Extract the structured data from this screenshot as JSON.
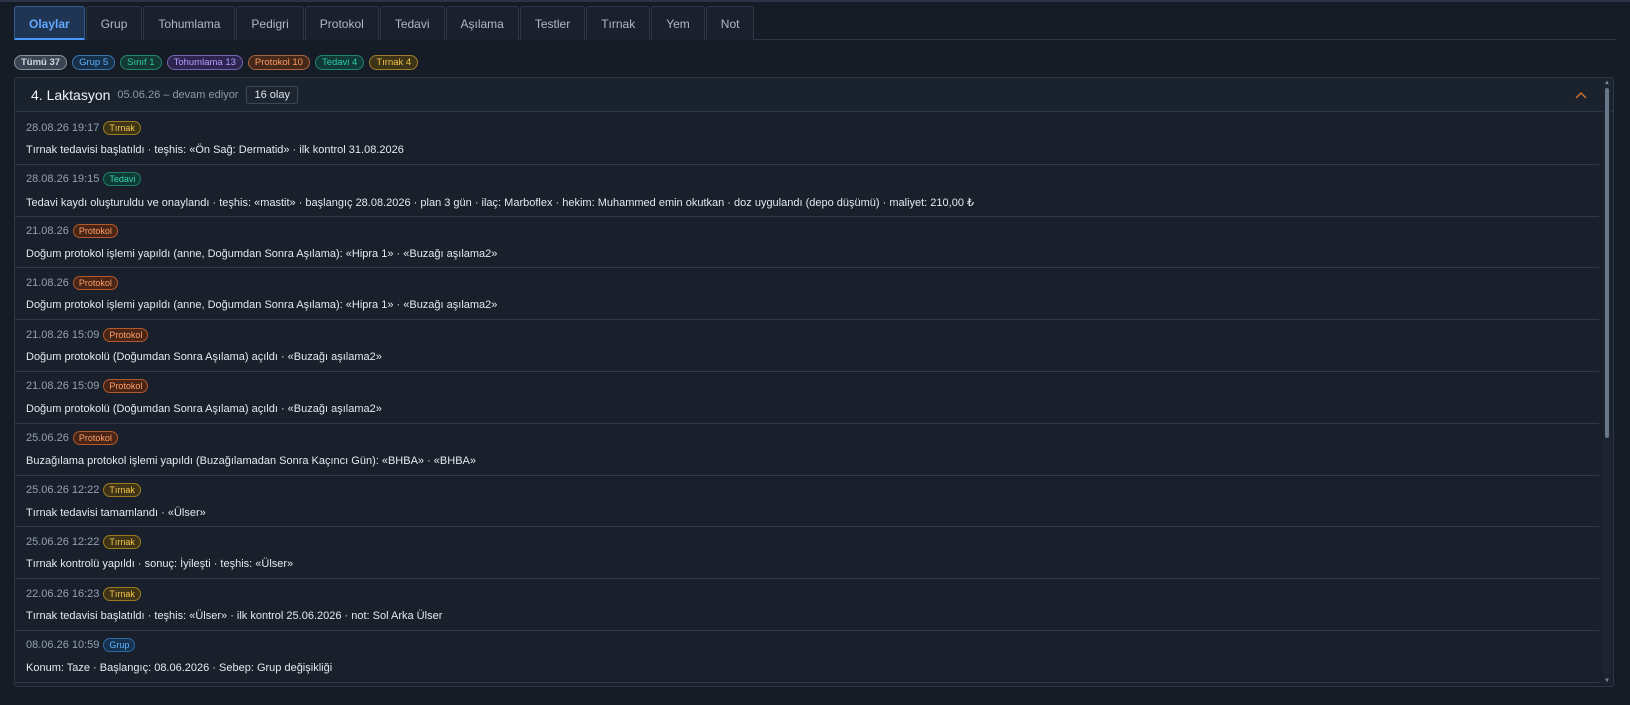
{
  "tabs": [
    {
      "label": "Olaylar",
      "active": true
    },
    {
      "label": "Grup"
    },
    {
      "label": "Tohumlama"
    },
    {
      "label": "Pedigri"
    },
    {
      "label": "Protokol"
    },
    {
      "label": "Tedavi"
    },
    {
      "label": "Aşılama"
    },
    {
      "label": "Testler"
    },
    {
      "label": "Tırnak"
    },
    {
      "label": "Yem"
    },
    {
      "label": "Not"
    }
  ],
  "filters": [
    {
      "label": "Tümü 37",
      "color": "#cfd6e0",
      "bg": "#3a4352",
      "active": true
    },
    {
      "label": "Grup 5",
      "color": "#5db2ff",
      "bg": "#173049"
    },
    {
      "label": "Sınıf 1",
      "color": "#34c8a0",
      "bg": "#123a33"
    },
    {
      "label": "Tohumlama 13",
      "color": "#b89bff",
      "bg": "#2c2550"
    },
    {
      "label": "Protokol 10",
      "color": "#ff9a60",
      "bg": "#45281a"
    },
    {
      "label": "Tedavi 4",
      "color": "#2ec9b0",
      "bg": "#113935"
    },
    {
      "label": "Tırnak 4",
      "color": "#f1c24a",
      "bg": "#3d3317"
    }
  ],
  "lactation": {
    "title": "4. Laktasyon",
    "range": "05.06.26 – devam ediyor",
    "count": "16 olay"
  },
  "tag_styles": {
    "Tırnak": {
      "color": "#f3c64d",
      "bg": "#3f3415",
      "border": "#9a7c22"
    },
    "Tedavi": {
      "color": "#36d1b4",
      "bg": "#0f3a34",
      "border": "#1f7d6d"
    },
    "Protokol": {
      "color": "#ffa06a",
      "bg": "#4a2414",
      "border": "#b25a2c"
    },
    "Grup": {
      "color": "#62b6ff",
      "bg": "#15324f",
      "border": "#2d6aa6"
    }
  },
  "events": [
    {
      "time": "28.08.26 19:17",
      "tag": "Tırnak",
      "desc": "Tırnak tedavisi başlatıldı · teşhis: «Ön Sağ: Dermatid» · ilk kontrol 31.08.2026"
    },
    {
      "time": "28.08.26 19:15",
      "tag": "Tedavi",
      "desc": "Tedavi kaydı oluşturuldu ve onaylandı · teşhis: «mastit» · başlangıç 28.08.2026 · plan 3 gün · ilaç: Marboflex · hekim: Muhammed emin okutkan · doz uygulandı (depo düşümü) · maliyet: 210,00 ₺"
    },
    {
      "time": "21.08.26",
      "tag": "Protokol",
      "desc": "Doğum protokol işlemi yapıldı (anne, Doğumdan Sonra Aşılama): «Hipra 1» · «Buzağı aşılama2»"
    },
    {
      "time": "21.08.26",
      "tag": "Protokol",
      "desc": "Doğum protokol işlemi yapıldı (anne, Doğumdan Sonra Aşılama): «Hipra 1» · «Buzağı aşılama2»"
    },
    {
      "time": "21.08.26 15:09",
      "tag": "Protokol",
      "desc": "Doğum protokolü (Doğumdan Sonra Aşılama) açıldı · «Buzağı aşılama2»"
    },
    {
      "time": "21.08.26 15:09",
      "tag": "Protokol",
      "desc": "Doğum protokolü (Doğumdan Sonra Aşılama) açıldı · «Buzağı aşılama2»"
    },
    {
      "time": "25.06.26",
      "tag": "Protokol",
      "desc": "Buzağılama protokol işlemi yapıldı (Buzağılamadan Sonra Kaçıncı Gün): «BHBA» · «BHBA»"
    },
    {
      "time": "25.06.26 12:22",
      "tag": "Tırnak",
      "desc": "Tırnak tedavisi tamamlandı · «Ülser»"
    },
    {
      "time": "25.06.26 12:22",
      "tag": "Tırnak",
      "desc": "Tırnak kontrolü yapıldı · sonuç: İyileşti · teşhis: «Ülser»"
    },
    {
      "time": "22.06.26 16:23",
      "tag": "Tırnak",
      "desc": "Tırnak tedavisi başlatıldı · teşhis: «Ülser» · ilk kontrol 25.06.2026 · not: Sol Arka Ülser"
    },
    {
      "time": "08.06.26 10:59",
      "tag": "Grup",
      "desc": "Konum: Taze · Başlangıç: 08.06.2026 · Sebep: Grup değişikliği"
    }
  ]
}
